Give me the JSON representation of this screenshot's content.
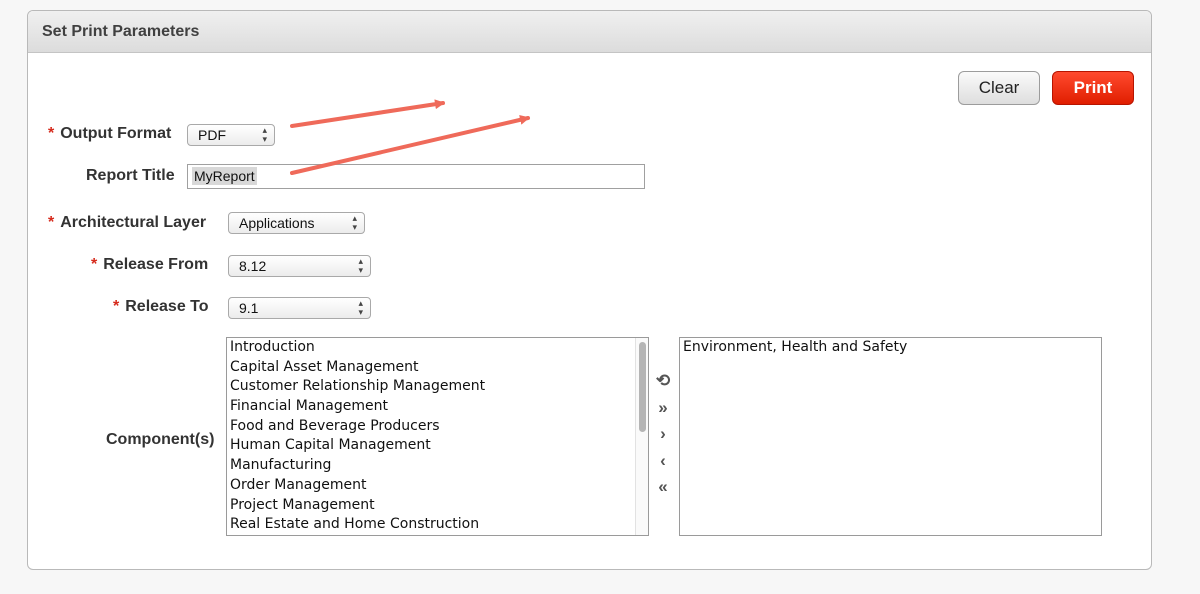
{
  "panel": {
    "title": "Set Print Parameters"
  },
  "buttons": {
    "clear": "Clear",
    "print": "Print"
  },
  "required_marker": "*",
  "form": {
    "output_format": {
      "label": "Output Format",
      "value": "PDF"
    },
    "report_title": {
      "label": "Report Title",
      "value": "MyReport"
    },
    "architectural_layer": {
      "label": "Architectural Layer",
      "value": "Applications"
    },
    "release_from": {
      "label": "Release From",
      "value": "8.12"
    },
    "release_to": {
      "label": "Release To",
      "value": "9.1"
    },
    "components": {
      "label": "Component(s)",
      "available": [
        "Introduction",
        "Capital Asset Management",
        "Customer Relationship Management",
        "Financial Management",
        "Food and Beverage Producers",
        "Human Capital Management",
        "Manufacturing",
        "Order Management",
        "Project Management",
        "Real Estate and Home Construction"
      ],
      "selected": [
        "Environment, Health and Safety"
      ]
    }
  },
  "shuttle_controls": [
    {
      "icon": "reset-icon",
      "glyph": "⟲"
    },
    {
      "icon": "move-all-right-icon",
      "glyph": "»"
    },
    {
      "icon": "move-right-icon",
      "glyph": "›"
    },
    {
      "icon": "move-left-icon",
      "glyph": "‹"
    },
    {
      "icon": "move-all-left-icon",
      "glyph": "«"
    }
  ],
  "colors": {
    "required": "#d62a1c",
    "print_button": "#e01e00",
    "annotation_arrow": "#ef6a5a"
  }
}
